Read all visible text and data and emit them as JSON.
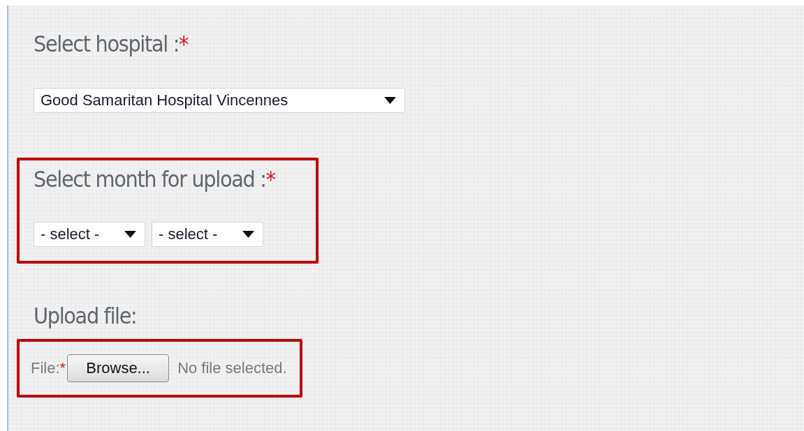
{
  "sections": [
    {
      "heading": "Select hospital :",
      "required_mark": "*",
      "kind": "select",
      "dropdowns": [
        {
          "value": "Good Samaritan Hospital Vincennes"
        }
      ]
    },
    {
      "heading": "Select month for upload :",
      "required_mark": "*",
      "highlighted": true,
      "kind": "select",
      "dropdowns": [
        {
          "value": "- select -"
        },
        {
          "value": "- select -"
        }
      ]
    },
    {
      "heading": "Upload file:",
      "highlighted": true,
      "kind": "file",
      "file": {
        "label": "File:",
        "required_mark": "*",
        "button": "Browse...",
        "status": "No file selected."
      }
    }
  ]
}
